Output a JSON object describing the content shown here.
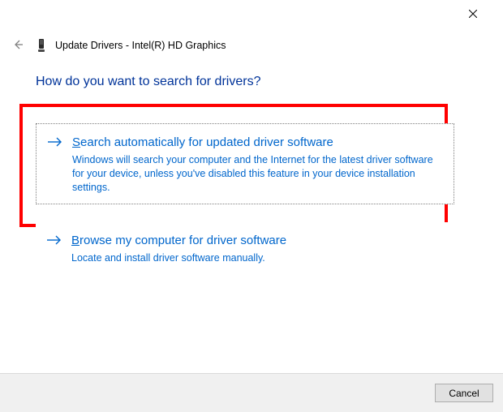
{
  "header": {
    "title": "Update Drivers - Intel(R) HD Graphics"
  },
  "heading": "How do you want to search for drivers?",
  "options": [
    {
      "title_pre": "S",
      "title_rest": "earch automatically for updated driver software",
      "description": "Windows will search your computer and the Internet for the latest driver software for your device, unless you've disabled this feature in your device installation settings."
    },
    {
      "title_pre": "B",
      "title_rest": "rowse my computer for driver software",
      "description": "Locate and install driver software manually."
    }
  ],
  "buttons": {
    "cancel": "Cancel"
  }
}
